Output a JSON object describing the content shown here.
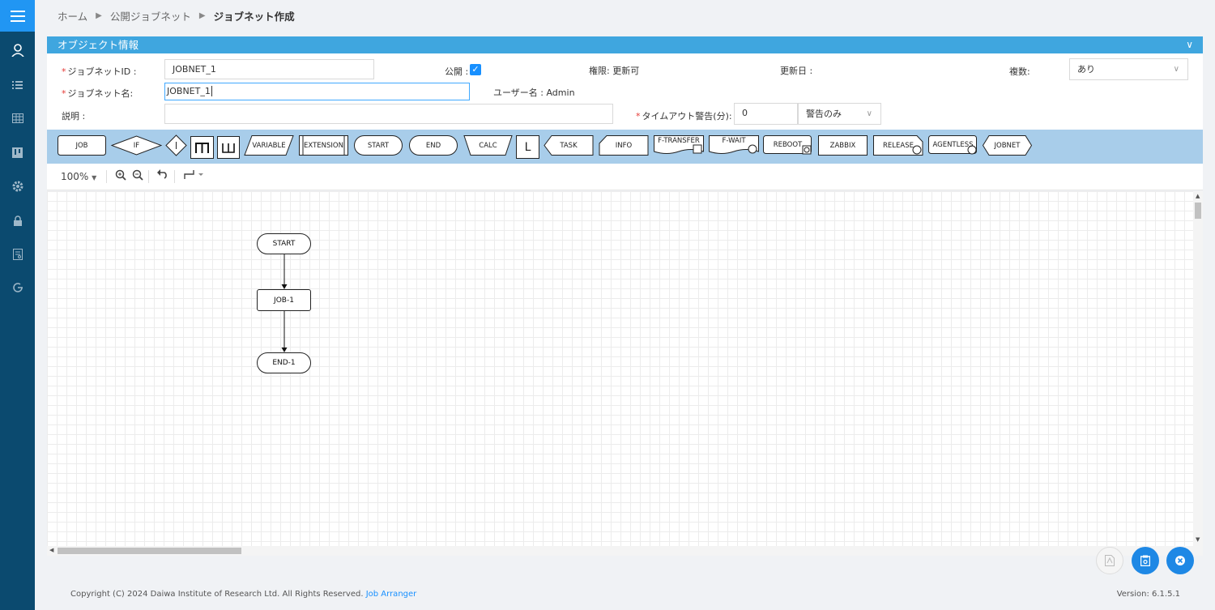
{
  "breadcrumb": {
    "home": "ホーム",
    "public": "公開ジョブネット",
    "current": "ジョブネット作成"
  },
  "panel": {
    "title": "オブジェクト情報",
    "jobnet_id_label": "ジョブネットID :",
    "jobnet_id_value": "JOBNET_1",
    "public_label": "公開 :",
    "public_checked": true,
    "authority": "権限: 更新可",
    "updated_label": "更新日 :",
    "multiple_label": "複数:",
    "multiple_value": "あり",
    "jobnet_name_label": "ジョブネット名:",
    "jobnet_name_value": "JOBNET_1",
    "username": "ユーザー名 : Admin",
    "description_label": "説明 :",
    "description_value": "",
    "timeout_label": "タイムアウト警告(分):",
    "timeout_value": "0",
    "timeout_mode": "警告のみ"
  },
  "toolbox": {
    "job": "JOB",
    "if": "IF",
    "variable": "VARIABLE",
    "extension": "EXTENSION",
    "start": "START",
    "end": "END",
    "calc": "CALC",
    "l": "L",
    "task": "TASK",
    "info": "INFO",
    "ftransfer": "F-TRANSFER",
    "fwait": "F-WAIT",
    "reboot": "REBOOT",
    "zabbix": "ZABBIX",
    "release": "RELEASE",
    "agentless": "AGENTLESS",
    "jobnet": "JOBNET",
    "loop_icon": "loop-icon",
    "merge_icon": "merge-icon"
  },
  "editbar": {
    "zoom": "100%"
  },
  "flow": {
    "start": "START",
    "job": "JOB-1",
    "end": "END-1"
  },
  "footer": {
    "copyright": "Copyright (C) 2024 Daiwa Institute of Research Ltd. All Rights Reserved.",
    "link": "Job Arranger",
    "version": "Version: 6.1.5.1"
  },
  "colors": {
    "sidebar": "#0b4a6f",
    "accent": "#2196f3",
    "panel_header": "#3fa6df",
    "toolbox": "#a8cdea"
  }
}
